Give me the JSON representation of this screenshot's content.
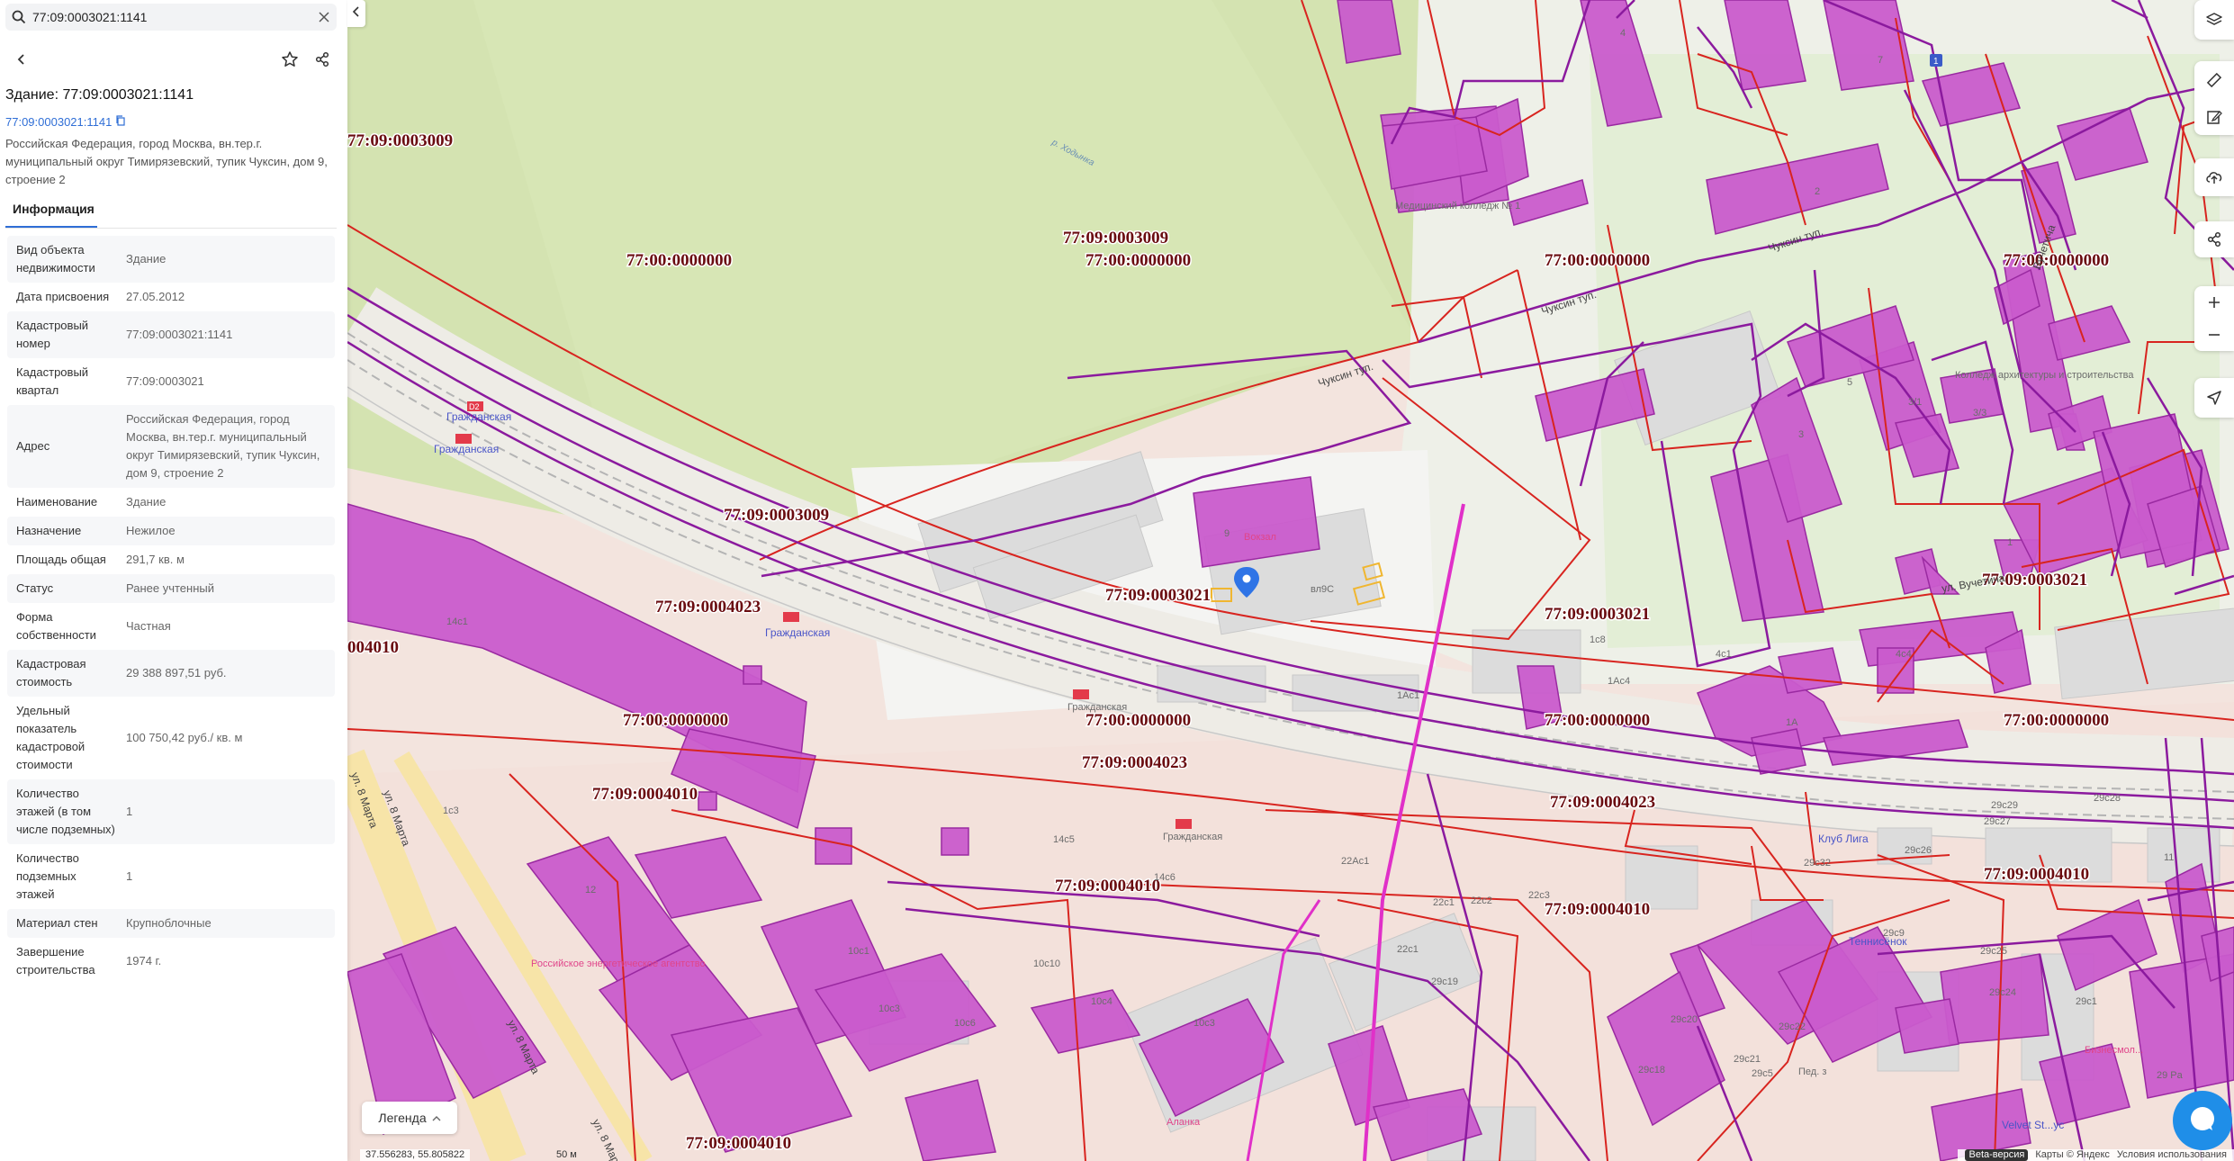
{
  "search": {
    "value": "77:09:0003021:1141"
  },
  "object": {
    "title": "Здание: 77:09:0003021:1141",
    "cad_number": "77:09:0003021:1141",
    "address": "Российская Федерация, город Москва, вн.тер.г. муниципальный округ Тимирязевский, тупик Чуксин, дом 9, строение 2"
  },
  "tabs": [
    {
      "label": "Информация",
      "active": true
    }
  ],
  "info_rows": [
    {
      "key": "Вид объекта недвижимости",
      "value": "Здание"
    },
    {
      "key": "Дата присвоения",
      "value": "27.05.2012"
    },
    {
      "key": "Кадастровый номер",
      "value": "77:09:0003021:1141"
    },
    {
      "key": "Кадастровый квартал",
      "value": "77:09:0003021"
    },
    {
      "key": "Адрес",
      "value": "Российская Федерация, город Москва, вн.тер.г. муниципальный округ Тимирязевский, тупик Чуксин, дом 9, строение 2"
    },
    {
      "key": "Наименование",
      "value": "Здание"
    },
    {
      "key": "Назначение",
      "value": "Нежилое"
    },
    {
      "key": "Площадь общая",
      "value": "291,7 кв. м"
    },
    {
      "key": "Статус",
      "value": "Ранее учтенный"
    },
    {
      "key": "Форма собственности",
      "value": "Частная"
    },
    {
      "key": "Кадастровая стоимость",
      "value": "29 388 897,51 руб."
    },
    {
      "key": "Удельный показатель кадастровой стоимости",
      "value": "100 750,42 руб./ кв. м"
    },
    {
      "key": "Количество этажей (в том числе подземных)",
      "value": "1"
    },
    {
      "key": "Количество подземных этажей",
      "value": "1"
    },
    {
      "key": "Материал стен",
      "value": "Крупноблочные"
    },
    {
      "key": "Завершение строительства",
      "value": "1974 г."
    }
  ],
  "map": {
    "cad_labels": [
      "77:00:0000000",
      "77:09:0003009",
      "77:00:0000000",
      "77:00:0000000",
      "77:00:0000000",
      "77:09:0003009",
      "77:09:0003009",
      "77:09:0004023",
      "77:09:0003021",
      "77:09:0003021",
      "77:09:0003021",
      "004010",
      "77:00:0000000",
      "77:00:0000000",
      "77:00:0000000",
      "77:00:0000000",
      "77:09:0004023",
      "77:09:0004023",
      "77:09:0004010",
      "77:09:0004010",
      "77:09:0004010",
      "77:09:0004010",
      "77:09:0004010"
    ],
    "stations": [
      "Гражданская",
      "Гражданская",
      "Гражданская",
      "Гражданская",
      "Гражданская"
    ],
    "line_badge": "D2",
    "streets": [
      "Чуксин туп.",
      "Чуксин туп.",
      "Чуксин туп.",
      "ул. Вучетича",
      "Вучетича",
      "ул. 8 Марта",
      "ул. 8 Марта",
      "ул. 8 Марта",
      "ул. 8 Марта"
    ],
    "river": "р. Ходынка",
    "pois": [
      {
        "name": "Вокзал",
        "color": "#e0458a"
      },
      {
        "name": "Пед. з",
        "color": "#e0458a"
      },
      {
        "name": "Теннисёнок",
        "color": "#4a55c8"
      },
      {
        "name": "Клуб Лига",
        "color": "#4a55c8"
      },
      {
        "name": "Velvet St...ус",
        "color": "#4a55c8"
      },
      {
        "name": "Бизнесмол...",
        "color": "#e0458a"
      },
      {
        "name": "Аланка",
        "color": "#e0458a"
      },
      {
        "name": "Российское энергетическое агентство",
        "color": "#e0458a"
      },
      {
        "name": "Медицинский колледж № 1",
        "color": "#e0458a"
      },
      {
        "name": "Колледж архитектуры и строительства",
        "color": "#e0458a"
      }
    ],
    "building_labels": [
      "14с1",
      "вл9С",
      "9",
      "1Ас1",
      "1Ас4",
      "1А",
      "12",
      "10с1",
      "10с3",
      "10с6",
      "10с4",
      "10с10",
      "10с3",
      "14с5",
      "14с6",
      "2",
      "3",
      "4",
      "5",
      "7",
      "1",
      "3/1",
      "3/3",
      "29с27",
      "29с28",
      "29с29",
      "29с26",
      "29с32",
      "29с9",
      "29с25",
      "29с24",
      "29с1",
      "29с20",
      "29с22",
      "29с21",
      "29с18",
      "29с19",
      "29с5",
      "22с1",
      "22с2",
      "22с3",
      "22Ас1",
      "22с1",
      "1",
      "1с4",
      "4с1",
      "4с2",
      "29 Pa",
      "2А",
      "1с8",
      "4с4",
      "11",
      "1с3"
    ],
    "route_number": "1",
    "coords_text": "37.556283, 55.805822",
    "scale_text": "50 м",
    "attribution": [
      "Beta-версия",
      "Карты © Яндекс",
      "Условия использования"
    ]
  },
  "legend": {
    "label": "Легенда"
  },
  "colors": {
    "accent": "#2f6ed6",
    "parcel_red": "#d8241f",
    "parcel_purple": "#8b1a9e",
    "building_magenta": "#c95bcc",
    "green_zone": "#d4e3b1"
  },
  "icons": [
    "search-icon",
    "close-icon",
    "back-icon",
    "star-icon",
    "share-icon",
    "copy-icon",
    "collapse-icon",
    "layers-icon",
    "ruler-icon",
    "edit-icon",
    "upload-icon",
    "share-map-icon",
    "zoom-in-icon",
    "zoom-out-icon",
    "locate-icon",
    "chevron-up-icon",
    "chat-icon"
  ]
}
